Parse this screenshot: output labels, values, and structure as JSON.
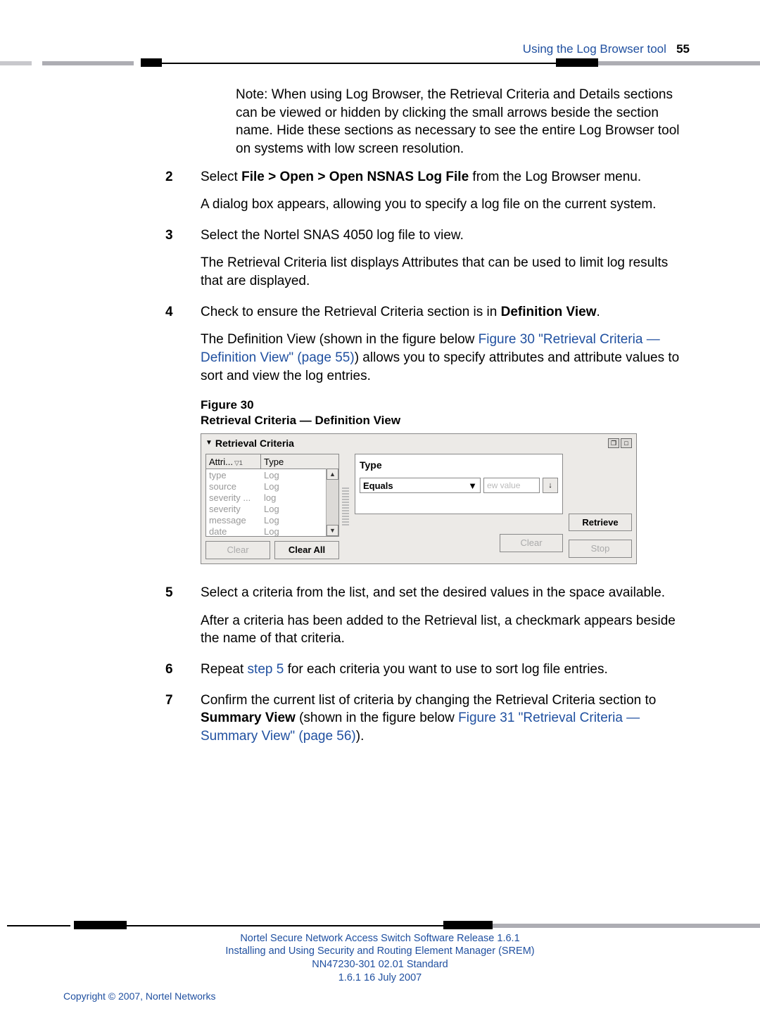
{
  "header": {
    "section": "Using the Log Browser tool",
    "page_num": "55"
  },
  "note": "Note:  When using Log Browser, the Retrieval Criteria and Details sections can be viewed or hidden by clicking the small arrows beside the section name.  Hide these sections as necessary to see the entire Log Browser tool on systems with low screen resolution.",
  "steps": {
    "s2": {
      "num": "2",
      "p1a": "Select ",
      "p1b": "File > Open > Open NSNAS Log File",
      "p1c": " from the Log Browser menu.",
      "p2": "A dialog box appears, allowing you to specify a log file on the current system."
    },
    "s3": {
      "num": "3",
      "p1": "Select the Nortel SNAS 4050 log file to view.",
      "p2": "The Retrieval Criteria list displays Attributes that can be used to limit log results that are displayed."
    },
    "s4": {
      "num": "4",
      "p1a": "Check to ensure the Retrieval Criteria section is in ",
      "p1b": "Definition View",
      "p1c": ".",
      "p2a": "The Definition View (shown in the figure below ",
      "p2link": "Figure 30 \"Retrieval Criteria — Definition View\" (page 55)",
      "p2b": ") allows you to specify attributes and attribute values to sort and view the log entries."
    },
    "fig": {
      "line1": "Figure 30",
      "line2": "Retrieval Criteria — Definition View"
    },
    "s5": {
      "num": "5",
      "p1": "Select a criteria from the list, and set the desired values in the space available.",
      "p2": "After a criteria has been added to the Retrieval list, a checkmark appears beside the name of that criteria."
    },
    "s6": {
      "num": "6",
      "p1a": "Repeat ",
      "p1link": "step 5",
      "p1b": " for each criteria you want to use to sort log file entries."
    },
    "s7": {
      "num": "7",
      "p1a": "Confirm the current list of criteria by changing the Retrieval Criteria section to ",
      "p1b": "Summary View",
      "p1c": " (shown in the figure below ",
      "p1link": "Figure 31 \"Retrieval Criteria — Summary View\" (page 56)",
      "p1d": ")."
    }
  },
  "panel": {
    "title": "Retrieval Criteria",
    "col1": "Attri...",
    "col2": "Type",
    "rows": [
      {
        "a": "type",
        "t": "Log"
      },
      {
        "a": "source",
        "t": "Log"
      },
      {
        "a": "severity ...",
        "t": "log"
      },
      {
        "a": "severity",
        "t": "Log"
      },
      {
        "a": "message",
        "t": "Log"
      },
      {
        "a": "date",
        "t": "Log"
      }
    ],
    "type_label": "Type",
    "equals": "Equals",
    "newvalue": "ew value",
    "clear": "Clear",
    "clear_all": "Clear All",
    "retrieve": "Retrieve",
    "stop": "Stop"
  },
  "footer": {
    "l1": "Nortel Secure Network Access Switch Software Release 1.6.1",
    "l2": "Installing and Using Security and Routing Element Manager (SREM)",
    "l3": "NN47230-301   02.01   Standard",
    "l4": "1.6.1   16 July 2007",
    "copy": "Copyright © 2007, Nortel Networks"
  }
}
